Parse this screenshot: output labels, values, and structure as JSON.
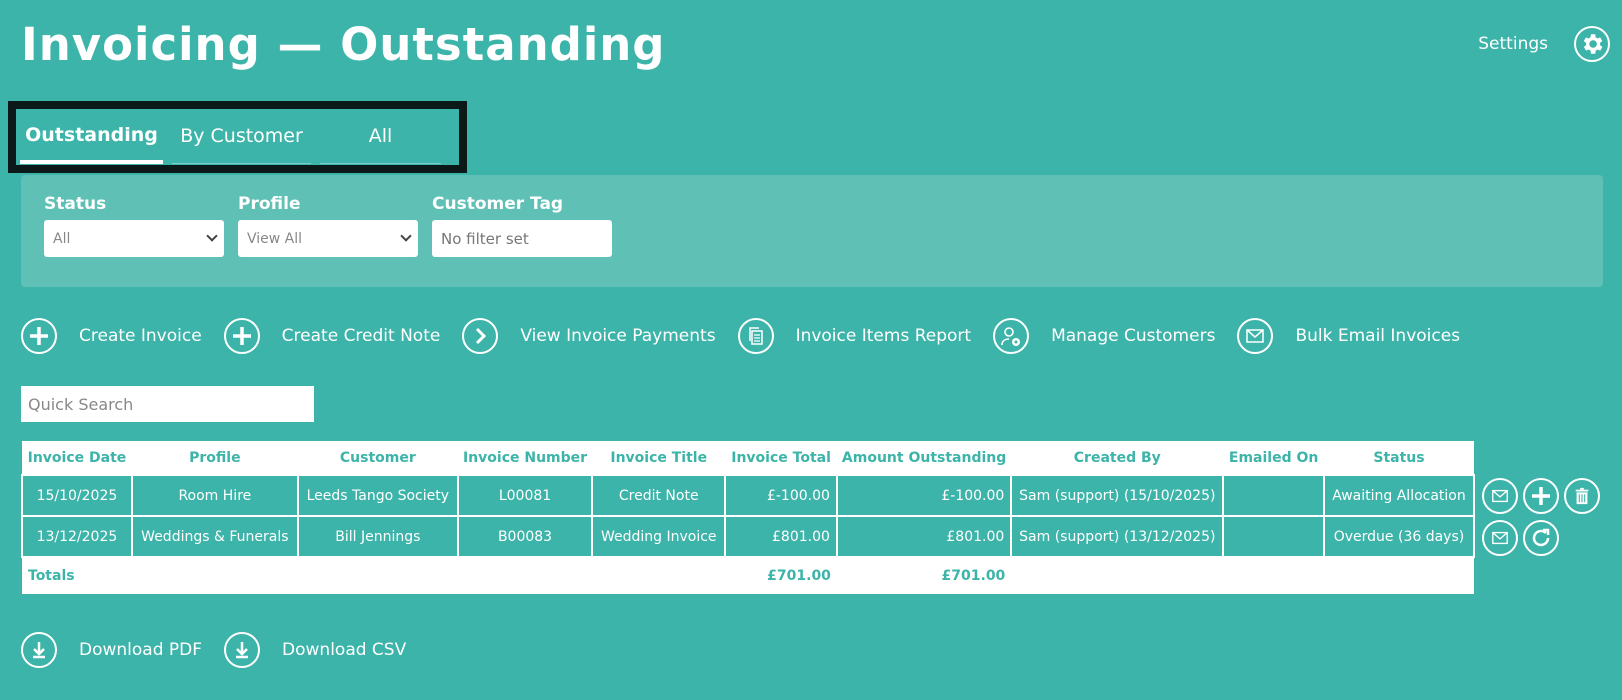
{
  "page": {
    "title": "Invoicing — Outstanding"
  },
  "header": {
    "settings_label": "Settings",
    "settings_icon": "gear-icon"
  },
  "tabs": [
    {
      "label": "Outstanding",
      "active": true
    },
    {
      "label": "By Customer",
      "active": false
    },
    {
      "label": "All",
      "active": false
    }
  ],
  "filters": {
    "status": {
      "label": "Status",
      "value": "All"
    },
    "profile": {
      "label": "Profile",
      "value": "View All"
    },
    "customer_tag": {
      "label": "Customer Tag",
      "placeholder": "No filter set"
    }
  },
  "actions": [
    {
      "label": "Create Invoice",
      "icon": "plus-icon"
    },
    {
      "label": "Create Credit Note",
      "icon": "plus-icon"
    },
    {
      "label": "View Invoice Payments",
      "icon": "chevron-right-icon"
    },
    {
      "label": "Invoice Items Report",
      "icon": "documents-icon"
    },
    {
      "label": "Manage Customers",
      "icon": "user-settings-icon"
    },
    {
      "label": "Bulk Email Invoices",
      "icon": "envelope-icon"
    }
  ],
  "search": {
    "placeholder": "Quick Search"
  },
  "table": {
    "headers": [
      "Invoice Date",
      "Profile",
      "Customer",
      "Invoice Number",
      "Invoice Title",
      "Invoice Total",
      "Amount Outstanding",
      "Created By",
      "Emailed On",
      "Status"
    ],
    "rows": [
      [
        "15/10/2025",
        "Room Hire",
        "Leeds Tango Society",
        "L00081",
        "Credit Note",
        "£-100.00",
        "£-100.00",
        "Sam (support) (15/10/2025)",
        "",
        "Awaiting Allocation"
      ],
      [
        "13/12/2025",
        "Weddings & Funerals",
        "Bill Jennings",
        "B00083",
        "Wedding Invoice",
        "£801.00",
        "£801.00",
        "Sam (support) (13/12/2025)",
        "",
        "Overdue (36 days)"
      ]
    ],
    "totals": {
      "label": "Totals",
      "invoice_total": "£701.00",
      "amount_outstanding": "£701.00"
    }
  },
  "downloads": [
    {
      "label": "Download PDF",
      "icon": "download-icon"
    },
    {
      "label": "Download CSV",
      "icon": "download-icon"
    }
  ]
}
